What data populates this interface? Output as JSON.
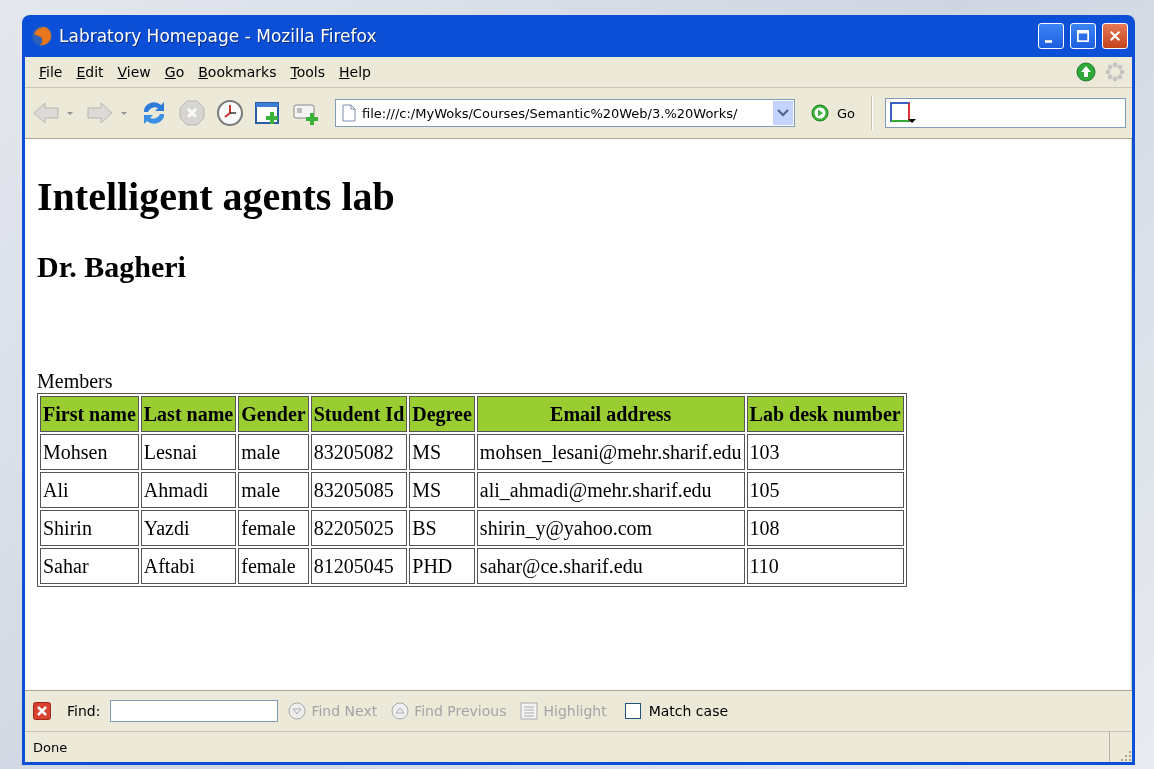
{
  "window": {
    "title": "Labratory Homepage - Mozilla Firefox"
  },
  "menu": [
    {
      "label": "File"
    },
    {
      "label": "Edit"
    },
    {
      "label": "View"
    },
    {
      "label": "Go"
    },
    {
      "label": "Bookmarks"
    },
    {
      "label": "Tools"
    },
    {
      "label": "Help"
    }
  ],
  "toolbar": {
    "buttons": [
      {
        "kind": "back",
        "disabled": true
      },
      {
        "kind": "forward",
        "disabled": true
      },
      {
        "kind": "reload",
        "disabled": false
      },
      {
        "kind": "stop",
        "disabled": true
      },
      {
        "kind": "history",
        "disabled": false
      },
      {
        "kind": "new-tab",
        "disabled": false
      },
      {
        "kind": "bookmark",
        "disabled": false
      }
    ],
    "address": "file:///c:/MyWoks/Courses/Semantic%20Web/3.%20Works/",
    "go_label": "Go"
  },
  "page": {
    "heading": "Intelligent agents lab",
    "subheading": "Dr. Bagheri",
    "caption": "Members",
    "table": {
      "columns": [
        "First name",
        "Last name",
        "Gender",
        "Student Id",
        "Degree",
        "Email address",
        "Lab desk number"
      ],
      "rows": [
        [
          "Mohsen",
          "Lesnai",
          "male",
          "83205082",
          "MS",
          "mohsen_lesani@mehr.sharif.edu",
          "103"
        ],
        [
          "Ali",
          "Ahmadi",
          "male",
          "83205085",
          "MS",
          "ali_ahmadi@mehr.sharif.edu",
          "105"
        ],
        [
          "Shirin",
          "Yazdi",
          "female",
          "82205025",
          "BS",
          "shirin_y@yahoo.com",
          "108"
        ],
        [
          "Sahar",
          "Aftabi",
          "female",
          "81205045",
          "PHD",
          "sahar@ce.sharif.edu",
          "110"
        ]
      ]
    }
  },
  "find_bar": {
    "label": "Find:",
    "buttons": [
      {
        "kind": "next",
        "label": "Find Next",
        "disabled": true
      },
      {
        "kind": "previous",
        "label": "Find Previous",
        "disabled": true
      },
      {
        "kind": "highlight",
        "label": "Highlight",
        "disabled": true
      }
    ],
    "match_case": {
      "label": "Match case",
      "checked": false
    }
  },
  "status_bar": {
    "text": "Done"
  }
}
